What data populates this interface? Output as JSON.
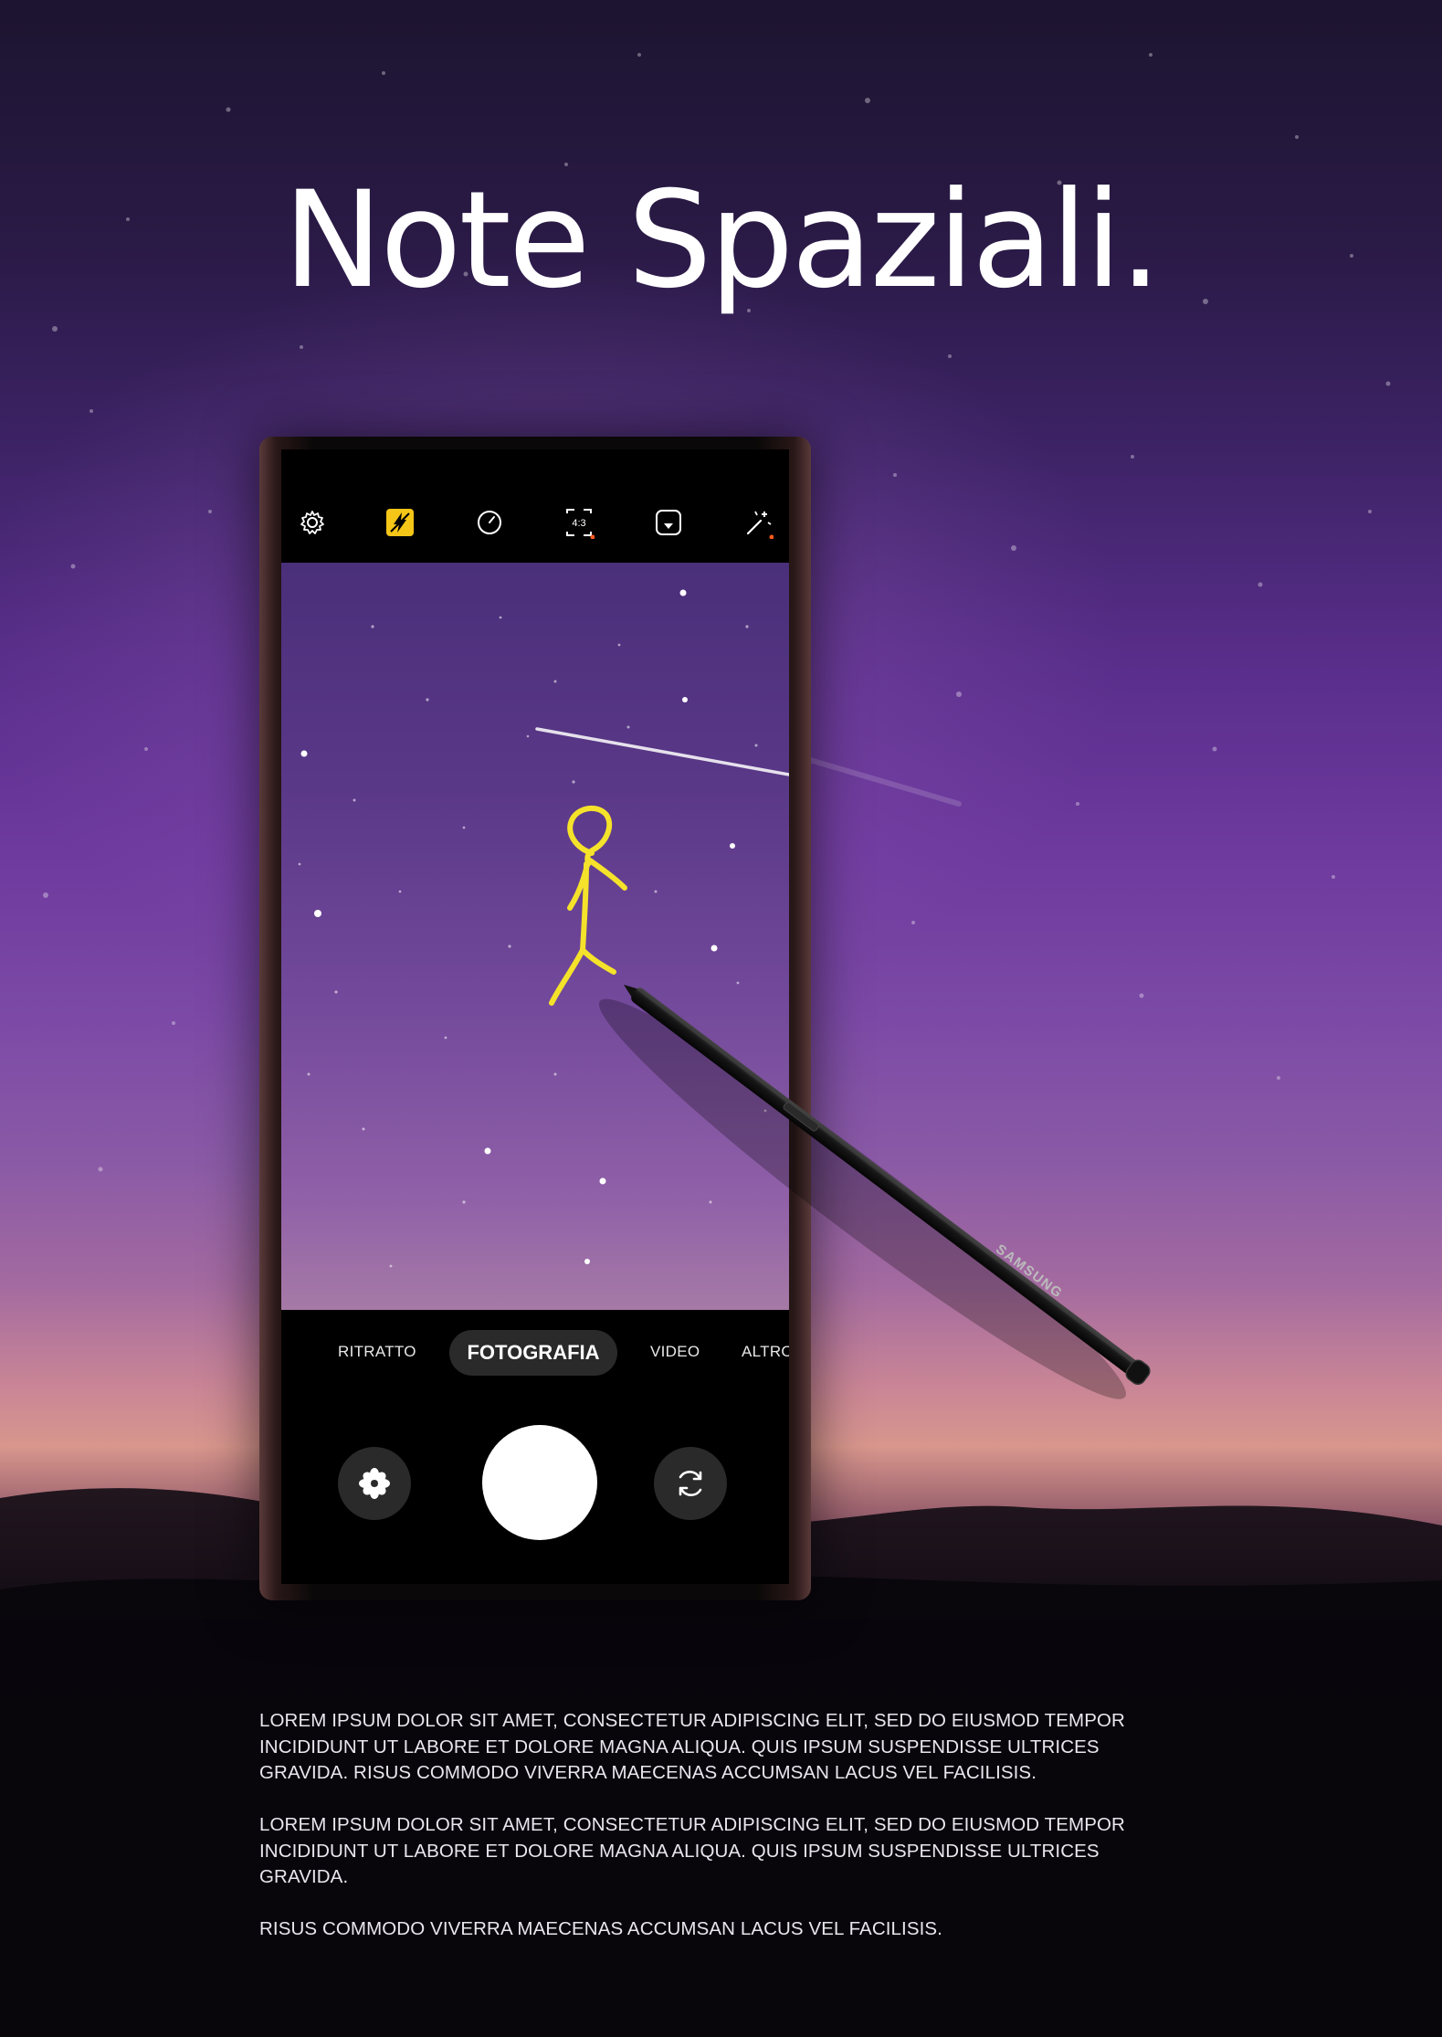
{
  "headline": "Note Spaziali.",
  "camera": {
    "top_icons": [
      "settings-icon",
      "flash-icon",
      "timer-icon",
      "aspect-ratio-icon",
      "motion-photo-icon",
      "filters-icon"
    ],
    "aspect_label": "4:3",
    "modes": {
      "portrait": "RITRATTO",
      "photo": "FOTOGRAFIA",
      "video": "VIDEO",
      "more": "ALTRO"
    },
    "active_mode": "FOTOGRAFIA",
    "accent_color": "#f5c518",
    "dot_color": "#ff5a1f"
  },
  "stylus": {
    "brand": "SAMSUNG"
  },
  "body": {
    "paragraph_1": "LOREM IPSUM DOLOR SIT AMET, CONSECTETUR ADIPISCING ELIT, SED DO EIUSMOD TEMPOR INCIDIDUNT UT LABORE ET DOLORE MAGNA ALIQUA. QUIS IPSUM SUSPENDISSE ULTRICES GRAVIDA. RISUS COMMODO VIVERRA MAECENAS ACCUMSAN LACUS VEL FACILISIS.",
    "paragraph_2": "LOREM IPSUM DOLOR SIT AMET, CONSECTETUR ADIPISCING ELIT, SED DO EIUSMOD TEMPOR INCIDIDUNT UT LABORE ET DOLORE MAGNA ALIQUA. QUIS IPSUM SUSPENDISSE ULTRICES GRAVIDA.",
    "paragraph_3": "RISUS COMMODO VIVERRA MAECENAS ACCUMSAN LACUS VEL FACILISIS."
  },
  "colors": {
    "sky_top": "#1c1430",
    "sky_mid": "#6e3a9e",
    "horizon": "#d8968d",
    "drawing": "#f5e22a"
  }
}
